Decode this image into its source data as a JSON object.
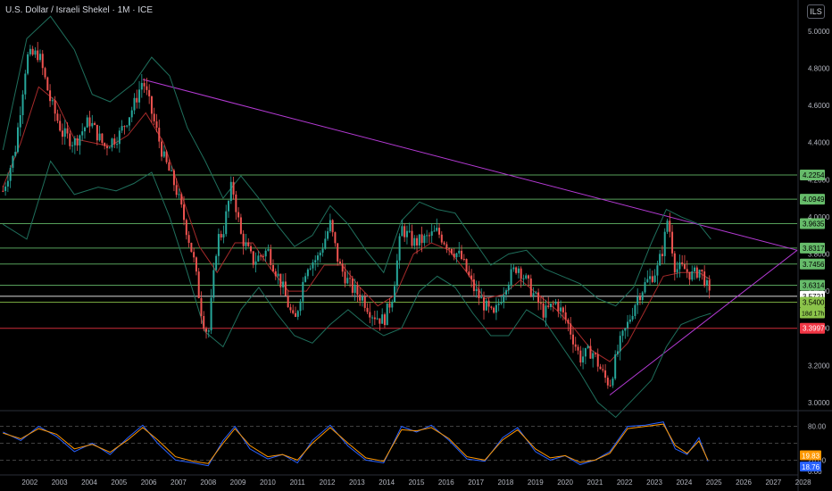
{
  "title": "U.S. Dollar / Israeli Shekel · 1M · ICE",
  "currency_label": "ILS",
  "chart_data": {
    "type": "line",
    "instrument": "U.S. Dollar / Israeli Shekel",
    "interval": "1M",
    "exchange": "ICE",
    "x_ticks": [
      "2002",
      "2003",
      "2004",
      "2005",
      "2006",
      "2007",
      "2008",
      "2009",
      "2010",
      "2011",
      "2012",
      "2013",
      "2014",
      "2015",
      "2016",
      "2017",
      "2018",
      "2019",
      "2020",
      "2021",
      "2022",
      "2023",
      "2024",
      "2025",
      "2026",
      "2027",
      "2028"
    ],
    "y_ticks": [
      "5.0000",
      "4.8000",
      "4.6000",
      "4.4000",
      "4.2000",
      "4.0000",
      "3.8000",
      "3.6000",
      "3.4000",
      "3.2000",
      "3.0000"
    ],
    "ylim": [
      2.98,
      5.12
    ],
    "xlim": [
      2001.5,
      2028.3
    ],
    "series": [
      {
        "values": [
          [
            2001.6,
            4.14
          ],
          [
            2002.0,
            4.35
          ],
          [
            2002.4,
            4.86
          ],
          [
            2002.8,
            4.88
          ],
          [
            2003.2,
            4.62
          ],
          [
            2003.6,
            4.45
          ],
          [
            2004.0,
            4.4
          ],
          [
            2004.5,
            4.52
          ],
          [
            2005.0,
            4.38
          ],
          [
            2005.5,
            4.44
          ],
          [
            2006.0,
            4.6
          ],
          [
            2006.3,
            4.74
          ],
          [
            2006.6,
            4.56
          ],
          [
            2007.0,
            4.32
          ],
          [
            2007.4,
            4.16
          ],
          [
            2007.7,
            3.98
          ],
          [
            2008.0,
            3.78
          ],
          [
            2008.3,
            3.46
          ],
          [
            2008.5,
            3.36
          ],
          [
            2008.8,
            3.88
          ],
          [
            2009.0,
            3.92
          ],
          [
            2009.3,
            4.18
          ],
          [
            2009.6,
            3.9
          ],
          [
            2010.0,
            3.76
          ],
          [
            2010.5,
            3.82
          ],
          [
            2011.0,
            3.62
          ],
          [
            2011.4,
            3.42
          ],
          [
            2011.8,
            3.74
          ],
          [
            2012.2,
            3.78
          ],
          [
            2012.6,
            3.96
          ],
          [
            2012.9,
            3.74
          ],
          [
            2013.3,
            3.62
          ],
          [
            2013.7,
            3.56
          ],
          [
            2014.0,
            3.48
          ],
          [
            2014.4,
            3.44
          ],
          [
            2014.7,
            3.58
          ],
          [
            2015.0,
            3.94
          ],
          [
            2015.4,
            3.86
          ],
          [
            2015.8,
            3.88
          ],
          [
            2016.2,
            3.92
          ],
          [
            2016.6,
            3.84
          ],
          [
            2017.0,
            3.78
          ],
          [
            2017.4,
            3.62
          ],
          [
            2017.8,
            3.52
          ],
          [
            2018.1,
            3.46
          ],
          [
            2018.5,
            3.64
          ],
          [
            2018.9,
            3.74
          ],
          [
            2019.3,
            3.62
          ],
          [
            2019.8,
            3.48
          ],
          [
            2020.2,
            3.54
          ],
          [
            2020.6,
            3.42
          ],
          [
            2021.0,
            3.24
          ],
          [
            2021.4,
            3.28
          ],
          [
            2021.8,
            3.14
          ],
          [
            2022.0,
            3.1
          ],
          [
            2022.3,
            3.3
          ],
          [
            2022.6,
            3.42
          ],
          [
            2022.9,
            3.56
          ],
          [
            2023.2,
            3.64
          ],
          [
            2023.6,
            3.72
          ],
          [
            2023.8,
            3.84
          ],
          [
            2023.95,
            4.0
          ],
          [
            2024.2,
            3.72
          ],
          [
            2024.5,
            3.72
          ],
          [
            2024.8,
            3.68
          ],
          [
            2025.0,
            3.72
          ],
          [
            2025.2,
            3.66
          ],
          [
            2025.4,
            3.54
          ]
        ]
      },
      {
        "values": [
          [
            2001.6,
            4.16
          ],
          [
            2002.2,
            4.4
          ],
          [
            2002.8,
            4.7
          ],
          [
            2003.4,
            4.62
          ],
          [
            2004.0,
            4.42
          ],
          [
            2004.6,
            4.4
          ],
          [
            2005.2,
            4.38
          ],
          [
            2005.8,
            4.44
          ],
          [
            2006.4,
            4.56
          ],
          [
            2007.0,
            4.4
          ],
          [
            2007.6,
            4.12
          ],
          [
            2008.2,
            3.84
          ],
          [
            2008.8,
            3.7
          ],
          [
            2009.4,
            3.86
          ],
          [
            2010.0,
            3.86
          ],
          [
            2010.6,
            3.72
          ],
          [
            2011.2,
            3.6
          ],
          [
            2011.8,
            3.6
          ],
          [
            2012.4,
            3.74
          ],
          [
            2013.0,
            3.74
          ],
          [
            2013.6,
            3.62
          ],
          [
            2014.2,
            3.52
          ],
          [
            2014.8,
            3.58
          ],
          [
            2015.4,
            3.8
          ],
          [
            2016.0,
            3.86
          ],
          [
            2016.6,
            3.82
          ],
          [
            2017.2,
            3.7
          ],
          [
            2017.8,
            3.56
          ],
          [
            2018.4,
            3.58
          ],
          [
            2019.0,
            3.66
          ],
          [
            2019.6,
            3.58
          ],
          [
            2020.2,
            3.5
          ],
          [
            2020.8,
            3.4
          ],
          [
            2021.4,
            3.28
          ],
          [
            2022.0,
            3.22
          ],
          [
            2022.6,
            3.32
          ],
          [
            2023.2,
            3.5
          ],
          [
            2023.8,
            3.68
          ],
          [
            2024.4,
            3.7
          ],
          [
            2025.0,
            3.7
          ],
          [
            2025.4,
            3.66
          ]
        ]
      },
      {
        "values": [
          [
            2001.6,
            4.36
          ],
          [
            2002.4,
            4.96
          ],
          [
            2003.2,
            5.08
          ],
          [
            2004.0,
            4.9
          ],
          [
            2004.6,
            4.66
          ],
          [
            2005.2,
            4.62
          ],
          [
            2006.0,
            4.72
          ],
          [
            2006.6,
            4.86
          ],
          [
            2007.2,
            4.76
          ],
          [
            2007.8,
            4.48
          ],
          [
            2008.4,
            4.3
          ],
          [
            2009.0,
            4.1
          ],
          [
            2009.6,
            4.22
          ],
          [
            2010.2,
            4.1
          ],
          [
            2010.8,
            3.96
          ],
          [
            2011.4,
            3.84
          ],
          [
            2012.0,
            3.9
          ],
          [
            2012.6,
            4.06
          ],
          [
            2013.2,
            3.96
          ],
          [
            2013.8,
            3.82
          ],
          [
            2014.4,
            3.7
          ],
          [
            2015.0,
            3.98
          ],
          [
            2015.6,
            4.08
          ],
          [
            2016.2,
            4.04
          ],
          [
            2016.8,
            4.02
          ],
          [
            2017.4,
            3.88
          ],
          [
            2018.0,
            3.74
          ],
          [
            2018.6,
            3.8
          ],
          [
            2019.2,
            3.82
          ],
          [
            2019.8,
            3.72
          ],
          [
            2020.4,
            3.68
          ],
          [
            2021.0,
            3.64
          ],
          [
            2021.6,
            3.56
          ],
          [
            2022.2,
            3.52
          ],
          [
            2022.8,
            3.62
          ],
          [
            2023.4,
            3.86
          ],
          [
            2023.9,
            4.04
          ],
          [
            2024.4,
            4.0
          ],
          [
            2025.0,
            3.96
          ],
          [
            2025.4,
            3.88
          ]
        ]
      },
      {
        "values": [
          [
            2001.6,
            3.96
          ],
          [
            2002.4,
            3.88
          ],
          [
            2003.2,
            4.3
          ],
          [
            2004.0,
            4.12
          ],
          [
            2004.8,
            4.16
          ],
          [
            2005.4,
            4.14
          ],
          [
            2006.0,
            4.18
          ],
          [
            2006.6,
            4.24
          ],
          [
            2007.2,
            4.0
          ],
          [
            2007.8,
            3.7
          ],
          [
            2008.4,
            3.38
          ],
          [
            2009.0,
            3.3
          ],
          [
            2009.6,
            3.5
          ],
          [
            2010.2,
            3.62
          ],
          [
            2010.8,
            3.48
          ],
          [
            2011.4,
            3.36
          ],
          [
            2012.0,
            3.32
          ],
          [
            2012.6,
            3.42
          ],
          [
            2013.2,
            3.5
          ],
          [
            2013.8,
            3.42
          ],
          [
            2014.4,
            3.36
          ],
          [
            2015.0,
            3.4
          ],
          [
            2015.6,
            3.6
          ],
          [
            2016.2,
            3.68
          ],
          [
            2016.8,
            3.62
          ],
          [
            2017.4,
            3.48
          ],
          [
            2018.0,
            3.36
          ],
          [
            2018.6,
            3.36
          ],
          [
            2019.2,
            3.5
          ],
          [
            2019.8,
            3.44
          ],
          [
            2020.4,
            3.3
          ],
          [
            2021.0,
            3.16
          ],
          [
            2021.6,
            3.0
          ],
          [
            2022.2,
            2.92
          ],
          [
            2022.8,
            3.02
          ],
          [
            2023.4,
            3.12
          ],
          [
            2023.9,
            3.3
          ],
          [
            2024.4,
            3.42
          ],
          [
            2025.0,
            3.46
          ],
          [
            2025.4,
            3.48
          ]
        ]
      }
    ],
    "trendlines": [
      {
        "from": [
          2006.3,
          4.74
        ],
        "to": [
          2028.3,
          3.82
        ]
      },
      {
        "from": [
          2022.0,
          3.04
        ],
        "to": [
          2028.3,
          3.82
        ]
      }
    ],
    "horizontal_levels": [
      {
        "value": 4.2254,
        "label": "4.2254",
        "color": "#66bb6a"
      },
      {
        "value": 4.0949,
        "label": "4.0949",
        "color": "#66bb6a"
      },
      {
        "value": 3.9635,
        "label": "3.9635",
        "color": "#66bb6a"
      },
      {
        "value": 3.8317,
        "label": "3.8317",
        "color": "#66bb6a"
      },
      {
        "value": 3.7456,
        "label": "3.7456",
        "color": "#66bb6a"
      },
      {
        "value": 3.6314,
        "label": "3.6314",
        "color": "#66bb6a"
      },
      {
        "value": 3.5721,
        "label": "3.5721",
        "color": "#ffffff"
      },
      {
        "value": 3.54,
        "label": "3.5400",
        "color": "#8bc34a"
      },
      {
        "value": 3.3997,
        "label": "3.3997",
        "color": "#f23645"
      }
    ],
    "countdown_label": "18d 17h",
    "oscillator": {
      "y_ticks": [
        "80.00",
        "20.00",
        "0.00"
      ],
      "ylim": [
        0,
        100
      ],
      "last_values": [
        {
          "label": "19.83",
          "color": "#ff9800"
        },
        {
          "label": "18.76",
          "color": "#2962ff"
        }
      ],
      "k": [
        [
          2001.6,
          70
        ],
        [
          2002.2,
          55
        ],
        [
          2002.8,
          80
        ],
        [
          2003.4,
          62
        ],
        [
          2004.0,
          35
        ],
        [
          2004.6,
          50
        ],
        [
          2005.2,
          30
        ],
        [
          2005.8,
          60
        ],
        [
          2006.3,
          82
        ],
        [
          2006.8,
          50
        ],
        [
          2007.4,
          20
        ],
        [
          2008.0,
          15
        ],
        [
          2008.5,
          10
        ],
        [
          2009.0,
          55
        ],
        [
          2009.4,
          80
        ],
        [
          2009.9,
          40
        ],
        [
          2010.5,
          22
        ],
        [
          2011.0,
          30
        ],
        [
          2011.5,
          15
        ],
        [
          2012.0,
          55
        ],
        [
          2012.6,
          82
        ],
        [
          2013.2,
          45
        ],
        [
          2013.8,
          20
        ],
        [
          2014.4,
          15
        ],
        [
          2015.0,
          80
        ],
        [
          2015.5,
          70
        ],
        [
          2016.0,
          82
        ],
        [
          2016.6,
          55
        ],
        [
          2017.2,
          22
        ],
        [
          2017.8,
          18
        ],
        [
          2018.4,
          60
        ],
        [
          2018.9,
          78
        ],
        [
          2019.5,
          35
        ],
        [
          2020.0,
          20
        ],
        [
          2020.5,
          28
        ],
        [
          2021.0,
          12
        ],
        [
          2021.5,
          20
        ],
        [
          2022.0,
          35
        ],
        [
          2022.6,
          80
        ],
        [
          2023.2,
          82
        ],
        [
          2023.8,
          88
        ],
        [
          2024.2,
          40
        ],
        [
          2024.6,
          30
        ],
        [
          2025.0,
          60
        ],
        [
          2025.3,
          18
        ]
      ],
      "d": [
        [
          2001.6,
          68
        ],
        [
          2002.2,
          58
        ],
        [
          2002.8,
          76
        ],
        [
          2003.4,
          66
        ],
        [
          2004.0,
          40
        ],
        [
          2004.6,
          48
        ],
        [
          2005.2,
          34
        ],
        [
          2005.8,
          56
        ],
        [
          2006.3,
          78
        ],
        [
          2006.8,
          56
        ],
        [
          2007.4,
          26
        ],
        [
          2008.0,
          18
        ],
        [
          2008.5,
          14
        ],
        [
          2009.0,
          50
        ],
        [
          2009.4,
          76
        ],
        [
          2009.9,
          46
        ],
        [
          2010.5,
          26
        ],
        [
          2011.0,
          30
        ],
        [
          2011.5,
          20
        ],
        [
          2012.0,
          50
        ],
        [
          2012.6,
          78
        ],
        [
          2013.2,
          50
        ],
        [
          2013.8,
          24
        ],
        [
          2014.4,
          18
        ],
        [
          2015.0,
          74
        ],
        [
          2015.5,
          72
        ],
        [
          2016.0,
          78
        ],
        [
          2016.6,
          58
        ],
        [
          2017.2,
          26
        ],
        [
          2017.8,
          20
        ],
        [
          2018.4,
          56
        ],
        [
          2018.9,
          74
        ],
        [
          2019.5,
          40
        ],
        [
          2020.0,
          24
        ],
        [
          2020.5,
          28
        ],
        [
          2021.0,
          16
        ],
        [
          2021.5,
          20
        ],
        [
          2022.0,
          32
        ],
        [
          2022.6,
          76
        ],
        [
          2023.2,
          80
        ],
        [
          2023.8,
          84
        ],
        [
          2024.2,
          46
        ],
        [
          2024.6,
          32
        ],
        [
          2025.0,
          54
        ],
        [
          2025.3,
          20
        ]
      ]
    }
  }
}
